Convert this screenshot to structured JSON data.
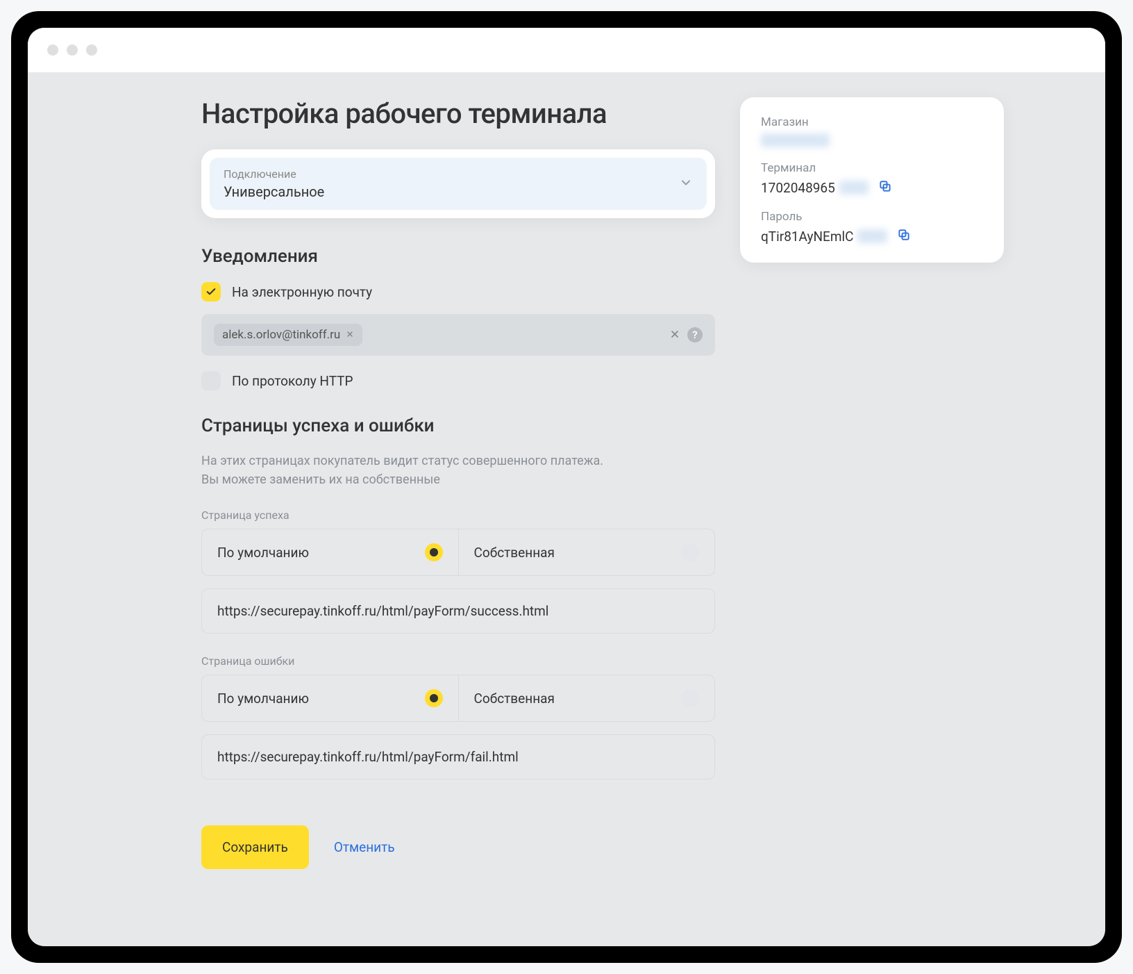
{
  "page_title": "Настройка рабочего терминала",
  "connection": {
    "label": "Подключение",
    "value": "Универсальное"
  },
  "notifications": {
    "title": "Уведомления",
    "email_checkbox_label": "На электронную почту",
    "email_chip": "alek.s.orlov@tinkoff.ru",
    "http_checkbox_label": "По протоколу HTTP"
  },
  "pages": {
    "title": "Страницы успеха и ошибки",
    "description_line1": "На этих страницах покупатель видит статус совершенного платежа.",
    "description_line2": "Вы можете заменить их на собственные",
    "success": {
      "label": "Страница успеха",
      "option_default": "По умолчанию",
      "option_custom": "Собственная",
      "url": "https://securepay.tinkoff.ru/html/payForm/success.html"
    },
    "error": {
      "label": "Страница ошибки",
      "option_default": "По умолчанию",
      "option_custom": "Собственная",
      "url": "https://securepay.tinkoff.ru/html/payForm/fail.html"
    }
  },
  "actions": {
    "save": "Сохранить",
    "cancel": "Отменить"
  },
  "sidebar": {
    "store_label": "Магазин",
    "store_value_masked": "████████",
    "terminal_label": "Терминал",
    "terminal_value": "1702048965",
    "terminal_masked_tail": "███",
    "password_label": "Пароль",
    "password_value": "qTir81AyNEmlC",
    "password_masked_tail": "███"
  }
}
